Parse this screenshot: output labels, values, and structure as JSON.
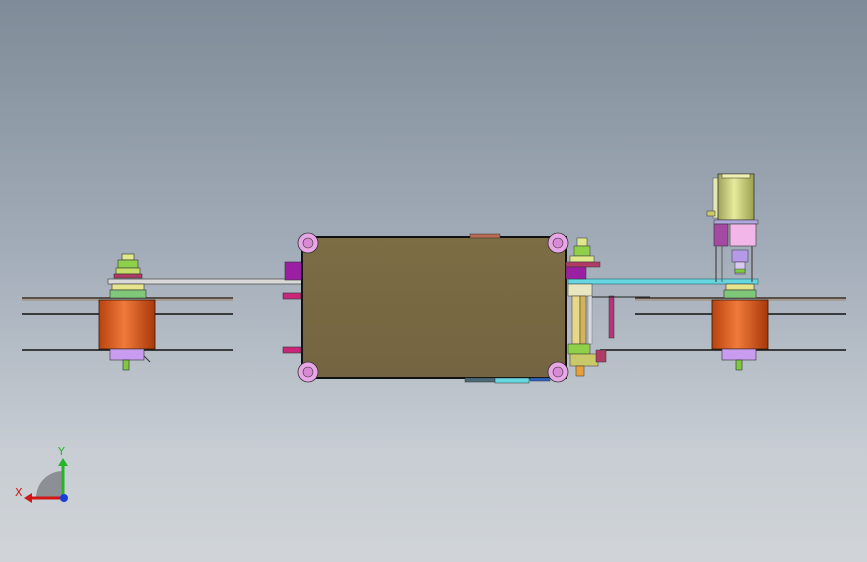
{
  "viewport": {
    "background_top": "#7f8b98",
    "background_bottom": "#d0d4d8"
  },
  "model": {
    "housing_color": "#7a6a42",
    "corner_boss_color": "#e9a6e6",
    "motor_color": "#d2561a",
    "motor_base_color": "#c99cf0",
    "cylinder_color": "#d2d98a",
    "green_part_color": "#7fc842",
    "cyan_bar_color": "#66d7e0",
    "magenta_block_color": "#9b1fa3"
  },
  "triad": {
    "x_label": "X",
    "y_label": "Y",
    "x_color": "#d11616",
    "y_color": "#27b427",
    "z_color": "#1a3fd6"
  }
}
